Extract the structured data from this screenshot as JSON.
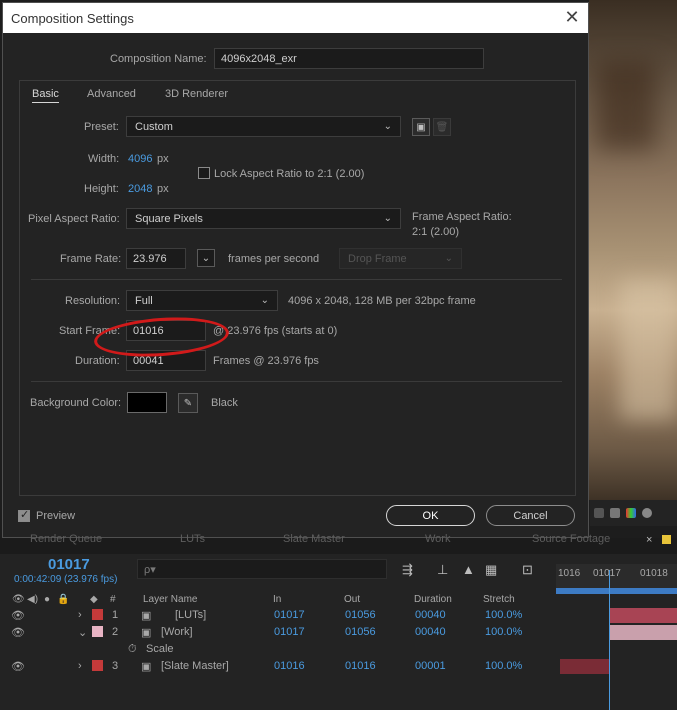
{
  "dialog": {
    "title": "Composition Settings",
    "close_icon": "close-icon",
    "comp_name_label": "Composition Name:",
    "comp_name_value": "4096x2048_exr",
    "tabs": [
      {
        "label": "Basic",
        "active": true
      },
      {
        "label": "Advanced",
        "active": false
      },
      {
        "label": "3D Renderer",
        "active": false
      }
    ],
    "preset_label": "Preset:",
    "preset_value": "Custom",
    "width_label": "Width:",
    "width_value": "4096",
    "width_unit": "px",
    "height_label": "Height:",
    "height_value": "2048",
    "height_unit": "px",
    "lock_aspect_label": "Lock Aspect Ratio to 2:1 (2.00)",
    "lock_aspect_checked": false,
    "par_label": "Pixel Aspect Ratio:",
    "par_value": "Square Pixels",
    "frame_aspect_label": "Frame Aspect Ratio:",
    "frame_aspect_value": "2:1 (2.00)",
    "frame_rate_label": "Frame Rate:",
    "frame_rate_value": "23.976",
    "frames_per_second": "frames per second",
    "drop_frame_value": "Drop Frame",
    "resolution_label": "Resolution:",
    "resolution_value": "Full",
    "resolution_info": "4096 x 2048, 128 MB per 32bpc frame",
    "start_frame_label": "Start Frame:",
    "start_frame_value": "01016",
    "start_frame_info": "@ 23.976 fps (starts at 0)",
    "duration_label": "Duration:",
    "duration_value": "00041",
    "duration_info": "Frames @ 23.976 fps",
    "bg_color_label": "Background Color:",
    "bg_color_value": "#000000",
    "bg_color_name": "Black",
    "preview_label": "Preview",
    "preview_checked": true,
    "ok_label": "OK",
    "cancel_label": "Cancel",
    "annotation_color": "#d11a1a"
  },
  "timeline": {
    "background_tabs": [
      "Render Queue",
      "LUTs",
      "Slate Master",
      "Work",
      "Source Footage"
    ],
    "current_time": "01017",
    "current_time_sub": "0:00:42:09 (23.976 fps)",
    "search_placeholder": "ρ▾",
    "columns": {
      "num": "#",
      "layer_name": "Layer Name",
      "in": "In",
      "out": "Out",
      "duration": "Duration",
      "stretch": "Stretch"
    },
    "layers": [
      {
        "num": "1",
        "name": "[LUTs]",
        "in": "01017",
        "out": "01056",
        "duration": "00040",
        "stretch": "100.0%",
        "color": "#c43a3a"
      },
      {
        "num": "2",
        "name": "[Work]",
        "in": "01017",
        "out": "01056",
        "duration": "00040",
        "stretch": "100.0%",
        "color": "#e8b4c4"
      },
      {
        "num": "3",
        "name": "[Slate Master]",
        "in": "01016",
        "out": "01016",
        "duration": "00001",
        "stretch": "100.0%",
        "color": "#c43a3a"
      }
    ],
    "property_label": "Scale",
    "ruler_labels": [
      "1016",
      "01017",
      "01018"
    ],
    "accent": "#4a9be0"
  }
}
